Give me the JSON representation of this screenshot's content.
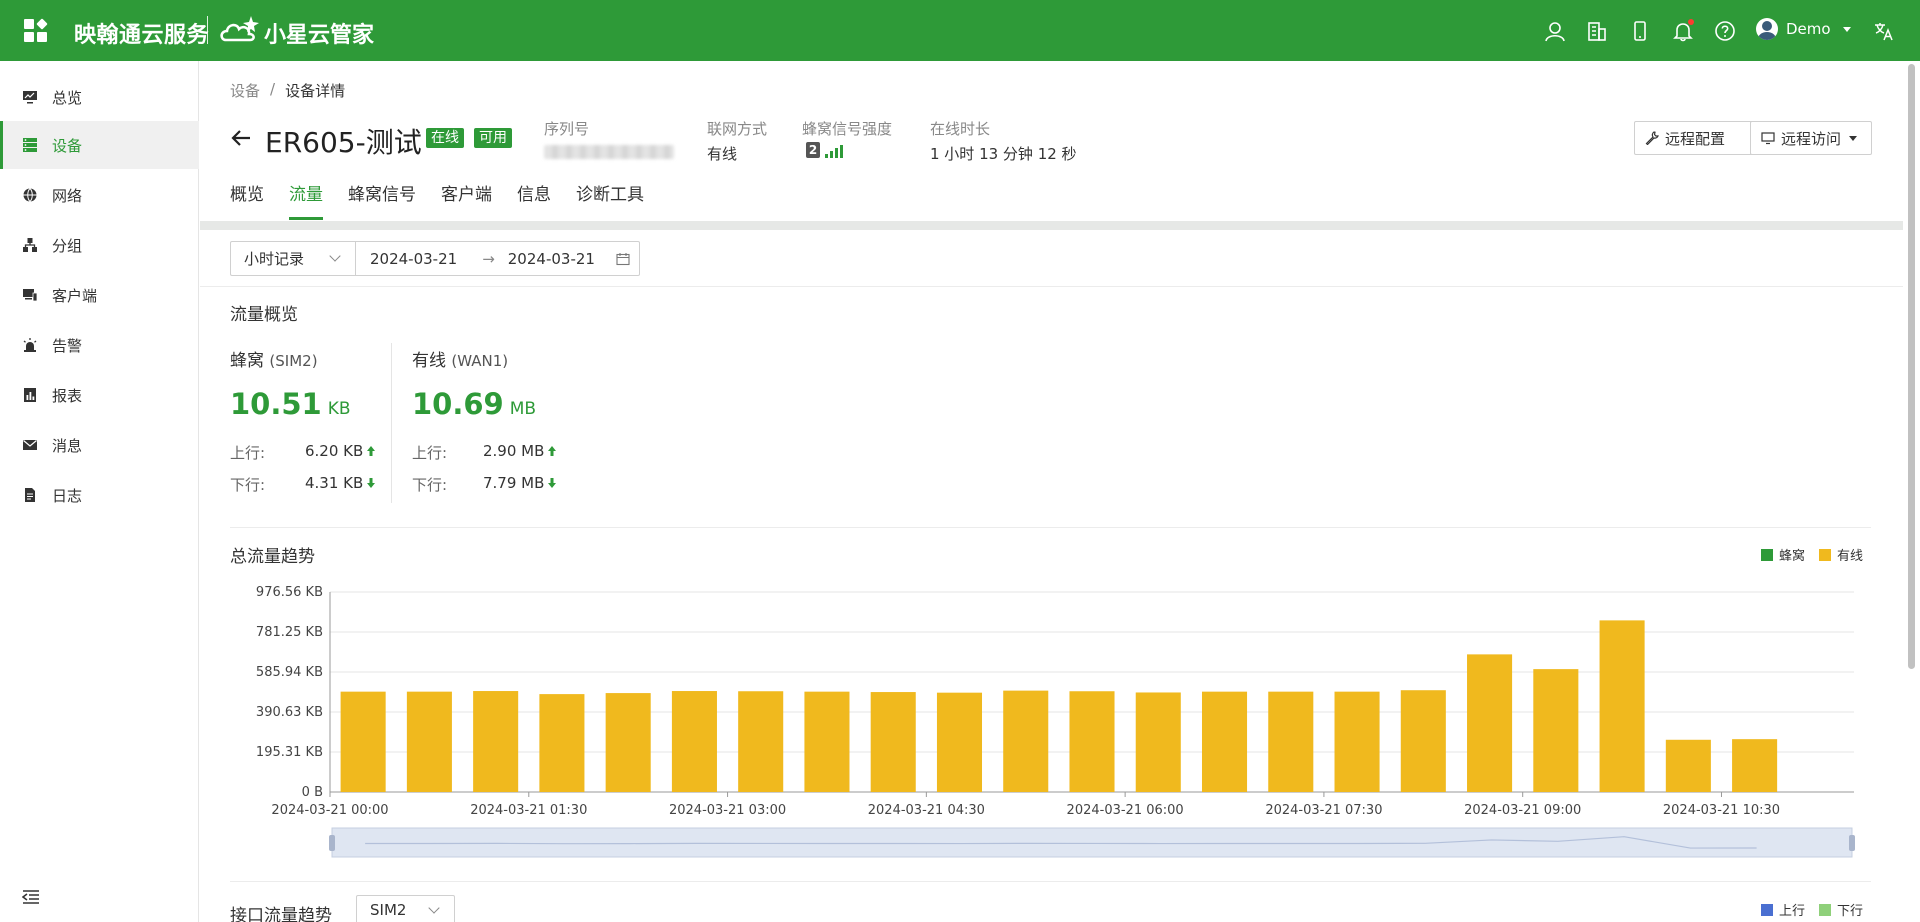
{
  "header": {
    "brand_primary": "映翰通云服务",
    "brand_secondary": "小星云管家",
    "user_name": "Demo",
    "icons": [
      "apps-icon",
      "user-icon",
      "building-icon",
      "mobile-icon",
      "bell-icon",
      "help-icon",
      "translate-icon"
    ],
    "notification_dot": true
  },
  "sidebar": {
    "items": [
      {
        "label": "总览",
        "icon": "monitor-icon"
      },
      {
        "label": "设备",
        "icon": "server-icon",
        "active": true
      },
      {
        "label": "网络",
        "icon": "globe-icon"
      },
      {
        "label": "分组",
        "icon": "hierarchy-icon"
      },
      {
        "label": "客户端",
        "icon": "devices-icon"
      },
      {
        "label": "告警",
        "icon": "alarm-icon"
      },
      {
        "label": "报表",
        "icon": "report-icon"
      },
      {
        "label": "消息",
        "icon": "mail-icon"
      },
      {
        "label": "日志",
        "icon": "log-icon"
      }
    ]
  },
  "breadcrumb": {
    "root": "设备",
    "sep": "/",
    "current": "设备详情"
  },
  "device": {
    "name": "ER605-测试",
    "status_badge": "在线",
    "availability_badge": "可用",
    "serial_label": "序列号",
    "network_label": "联网方式",
    "network_value": "有线",
    "signal_label": "蜂窝信号强度",
    "signal_sim": "2",
    "signal_level": 4,
    "uptime_label": "在线时长",
    "uptime_value": "1 小时 13 分钟 12 秒"
  },
  "actions": {
    "remote_config": "远程配置",
    "remote_access": "远程访问"
  },
  "tabs": [
    "概览",
    "流量",
    "蜂窝信号",
    "客户端",
    "信息",
    "诊断工具"
  ],
  "active_tab": "流量",
  "filters": {
    "granularity": "小时记录",
    "start_date": "2024-03-21",
    "range_arrow": "→",
    "end_date": "2024-03-21"
  },
  "overview": {
    "title": "流量概览",
    "up_label": "上行:",
    "down_label": "下行:",
    "cellular": {
      "name": "蜂窝",
      "iface": "(SIM2)",
      "total": "10.51",
      "unit": "KB",
      "up": "6.20 KB",
      "down": "4.31 KB"
    },
    "wired": {
      "name": "有线",
      "iface": "(WAN1)",
      "total": "10.69",
      "unit": "MB",
      "up": "2.90 MB",
      "down": "7.79 MB"
    }
  },
  "trend": {
    "title": "总流量趋势",
    "legend": [
      {
        "name": "蜂窝",
        "color": "#2e9a38"
      },
      {
        "name": "有线",
        "color": "#f0b91e"
      }
    ]
  },
  "chart_data": {
    "type": "bar",
    "x_ticks": [
      "2024-03-21 00:00",
      "2024-03-21 01:30",
      "2024-03-21 03:00",
      "2024-03-21 04:30",
      "2024-03-21 06:00",
      "2024-03-21 07:30",
      "2024-03-21 09:00",
      "2024-03-21 10:30"
    ],
    "y_ticks": [
      "976.56 KB",
      "781.25 KB",
      "585.94 KB",
      "390.63 KB",
      "195.31 KB",
      "0 B"
    ],
    "ylim_kb": [
      0,
      976.56
    ],
    "bar_interval_minutes": 30,
    "series": [
      {
        "name": "有线",
        "color": "#f0b91e",
        "values_kb": [
          490,
          490,
          493,
          478,
          483,
          493,
          492,
          490,
          488,
          485,
          495,
          492,
          486,
          490,
          490,
          490,
          497,
          672,
          600,
          838,
          255,
          258
        ]
      },
      {
        "name": "蜂窝",
        "color": "#2e9a38",
        "values_kb": [
          0.5,
          0.5,
          0.5,
          0.5,
          0.5,
          0.5,
          0.5,
          0.5,
          0.5,
          0.5,
          0.5,
          0.5,
          0.5,
          0.5,
          0.5,
          0.5,
          0.5,
          0.5,
          0.5,
          0.5,
          0.5,
          0.5
        ]
      }
    ],
    "grid": true
  },
  "iface_trend": {
    "title": "接口流量趋势",
    "selected": "SIM2",
    "legend": [
      {
        "name": "上行",
        "color": "#4a6fd1"
      },
      {
        "name": "下行",
        "color": "#8fd07a"
      }
    ]
  }
}
